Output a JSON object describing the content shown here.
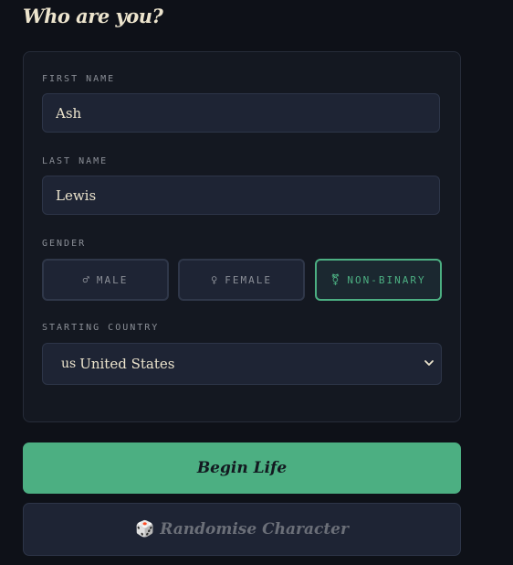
{
  "heading": "Who are you?",
  "form": {
    "first_name": {
      "label": "FIRST NAME",
      "value": "Ash"
    },
    "last_name": {
      "label": "LAST NAME",
      "value": "Lewis"
    },
    "gender": {
      "label": "GENDER",
      "options": [
        {
          "symbol": "♂",
          "label": "MALE",
          "selected": false
        },
        {
          "symbol": "♀",
          "label": "FEMALE",
          "selected": false
        },
        {
          "symbol": "⚧",
          "label": "NON-BINARY",
          "selected": true
        }
      ]
    },
    "country": {
      "label": "STARTING COUNTRY",
      "flag": "us",
      "value": "United States"
    }
  },
  "actions": {
    "begin_label": "Begin Life",
    "randomise_icon": "🎲",
    "randomise_label": "Randomise Character"
  },
  "colors": {
    "accent": "#4caf82",
    "background": "#0e1118",
    "card": "#141821",
    "field": "#1e2434",
    "text": "#ece4cd",
    "muted": "#8b8f97"
  }
}
